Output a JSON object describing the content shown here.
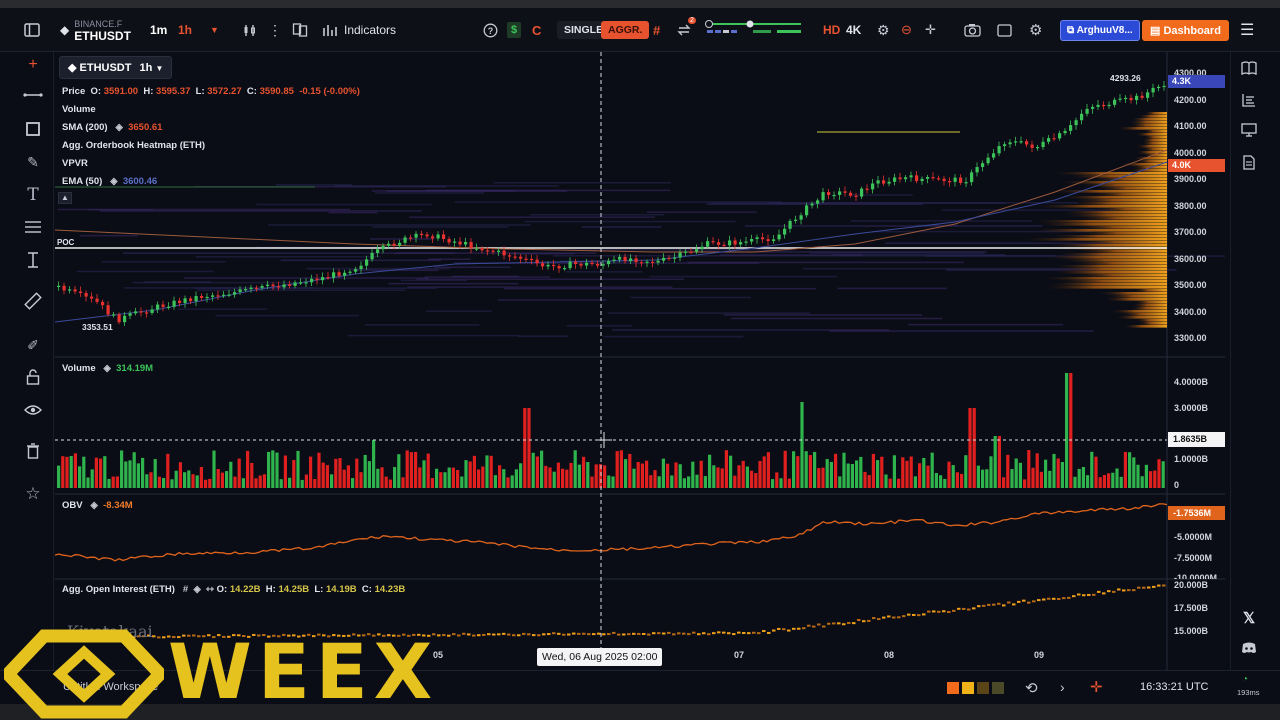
{
  "toolbar": {
    "exchange": "BINANCE.F",
    "symbol": "ETHUSDT",
    "interval_1": "1m",
    "interval_2": "1h",
    "indicators_label": "Indicators",
    "single_label": "SINGLE",
    "aggr_label": "AGGR.",
    "notif_count": "2",
    "hd_label": "HD",
    "k4_label": "4K",
    "user_label": "ArghuuV8...",
    "dashboard_label": "Dashboard",
    "colors": {
      "accent_red": "#e8532f",
      "green": "#3cc35a",
      "blue_btn": "#2b4bd6",
      "orange_btn": "#f26b1d"
    }
  },
  "chart_header": {
    "symbol": "ETHUSDT",
    "interval": "1h"
  },
  "legend": {
    "price_label": "Price",
    "o_label": "O:",
    "o_val": "3591.00",
    "h_label": "H:",
    "h_val": "3595.37",
    "l_label": "L:",
    "l_val": "3572.27",
    "c_label": "C:",
    "c_val": "3590.85",
    "change": "-0.15 (-0.00%)",
    "volume_label": "Volume",
    "sma_label": "SMA (200)",
    "sma_val": "3650.61",
    "heatmap_label": "Agg. Orderbook Heatmap (ETH)",
    "vpvr_label": "VPVR",
    "ema_label": "EMA (50)",
    "ema_val": "3600.46",
    "poc_label": "POC",
    "low_marker": "3353.51",
    "high_marker": "4293.26"
  },
  "volume_pane": {
    "label": "Volume",
    "value": "314.19M",
    "axis": [
      "4.0000B",
      "3.0000B",
      "1.0000B",
      "0"
    ],
    "crosshair_value": "1.8635B"
  },
  "obv_pane": {
    "label": "OBV",
    "value": "-8.34M",
    "axis": [
      "-5.0000M",
      "-7.5000M"
    ],
    "axis_partial": "-10.0000M",
    "current": "-1.7536M"
  },
  "oi_pane": {
    "label": "Agg. Open Interest (ETH)",
    "o_label": "O:",
    "o_val": "14.22B",
    "h_label": "H:",
    "h_val": "14.25B",
    "l_label": "L:",
    "l_val": "14.19B",
    "c_label": "C:",
    "c_val": "14.23B",
    "axis": [
      "20.000B",
      "17.500B",
      "15.000B"
    ],
    "watermark": "Kiyotakaai"
  },
  "price_axis": {
    "labels": [
      "4300.00",
      "4200.00",
      "4100.00",
      "4000.00",
      "3900.00",
      "3800.00",
      "3700.00",
      "3600.00",
      "3500.00",
      "3400.00",
      "3300.00"
    ],
    "badge_top": "4.3K",
    "badge_red": "4.0K"
  },
  "time_axis": {
    "labels": [
      "05",
      "07",
      "08",
      "09"
    ],
    "crosshair_time": "Wed, 06 Aug 2025 02:00"
  },
  "bottom": {
    "workspace": "Untitled Workspace",
    "clock": "16:33:21 UTC",
    "latency": "193ms"
  },
  "overlay": {
    "brand": "WEEX"
  }
}
